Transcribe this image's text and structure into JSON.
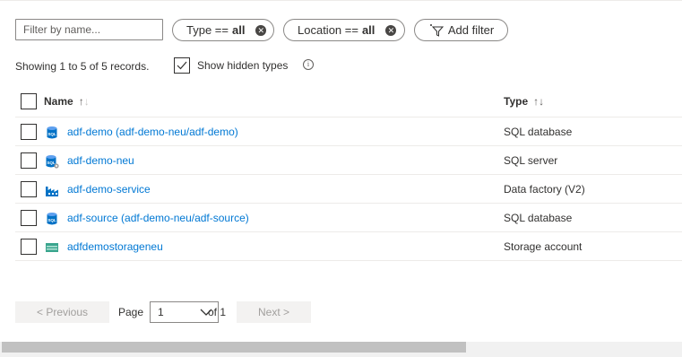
{
  "filter": {
    "placeholder": "Filter by name..."
  },
  "pills": {
    "type": {
      "label": "Type ==",
      "value": "all"
    },
    "location": {
      "label": "Location ==",
      "value": "all"
    },
    "add_filter": "Add filter"
  },
  "summary": {
    "records": "Showing 1 to 5 of 5 records.",
    "show_hidden_label": "Show hidden types",
    "show_hidden_checked": true
  },
  "table": {
    "headers": {
      "name": "Name",
      "type": "Type"
    },
    "rows": [
      {
        "name": "adf-demo (adf-demo-neu/adf-demo)",
        "type": "SQL database",
        "icon": "sql-database-icon"
      },
      {
        "name": "adf-demo-neu",
        "type": "SQL server",
        "icon": "sql-server-icon"
      },
      {
        "name": "adf-demo-service",
        "type": "Data factory (V2)",
        "icon": "data-factory-icon"
      },
      {
        "name": "adf-source (adf-demo-neu/adf-source)",
        "type": "SQL database",
        "icon": "sql-database-icon"
      },
      {
        "name": "adfdemostorageneu",
        "type": "Storage account",
        "icon": "storage-account-icon"
      }
    ]
  },
  "pager": {
    "previous": "< Previous",
    "page_label": "Page",
    "page_value": "1",
    "of_label": "of 1",
    "next": "Next >"
  },
  "colors": {
    "link": "#0078d4",
    "sql_icon": "#0072c6",
    "storage_icon": "#3aa58e"
  }
}
